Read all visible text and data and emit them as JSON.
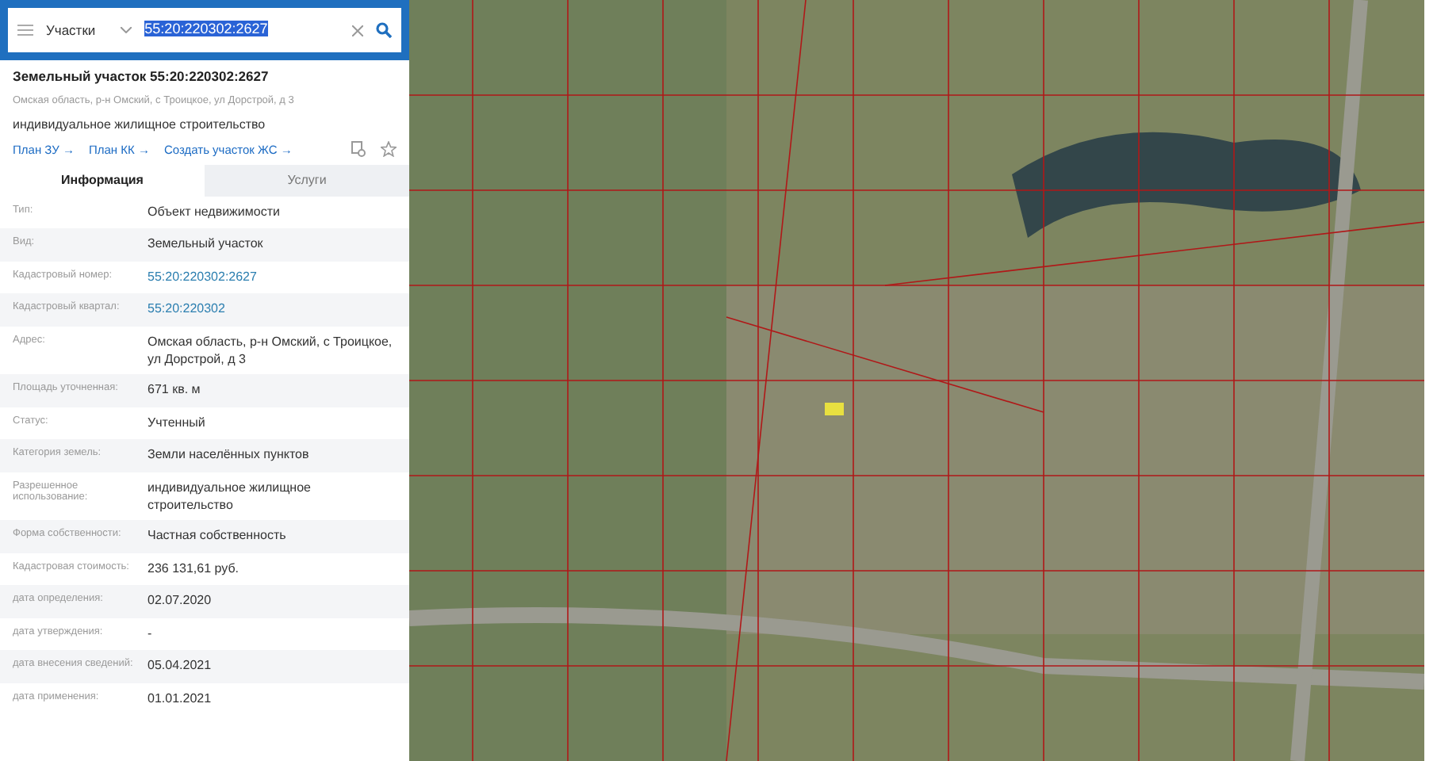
{
  "search": {
    "category": "Участки",
    "query": "55:20:220302:2627",
    "query_highlighted": true
  },
  "parcel": {
    "title": "Земельный участок 55:20:220302:2627",
    "address": "Омская область, р-н Омский, с Троицкое, ул Дорстрой, д 3",
    "usage": "индивидуальное жилищное строительство",
    "links": [
      "План ЗУ →",
      "План КК →",
      "Создать участок ЖС →"
    ]
  },
  "tabs": [
    {
      "label": "Информация",
      "selected": true
    },
    {
      "label": "Услуги",
      "selected": false
    }
  ],
  "properties": [
    {
      "label": "Тип:",
      "value": "Объект недвижимости",
      "kind": "text"
    },
    {
      "label": "Вид:",
      "value": "Земельный участок",
      "kind": "text"
    },
    {
      "label": "Кадастровый номер:",
      "value": "55:20:220302:2627",
      "kind": "link"
    },
    {
      "label": "Кадастровый квартал:",
      "value": "55:20:220302",
      "kind": "link"
    },
    {
      "label": "Адрес:",
      "value": "Омская область, р-н Омский, с Троицкое, ул Дорстрой, д 3",
      "kind": "text"
    },
    {
      "label": "Площадь уточненная:",
      "value": "671 кв. м",
      "kind": "text"
    },
    {
      "label": "Статус:",
      "value": "Учтенный",
      "kind": "text"
    },
    {
      "label": "Категория земель:",
      "value": "Земли населённых пунктов",
      "kind": "text"
    },
    {
      "label": "Разрешенное использование:",
      "value": "индивидуальное жилищное строительство",
      "kind": "text"
    },
    {
      "label": "Форма собственности:",
      "value": "Частная собственность",
      "kind": "text"
    },
    {
      "label": "Кадастровая стоимость:",
      "value": "236 131,61 руб.",
      "kind": "text"
    },
    {
      "label": "дата определения:",
      "value": "02.07.2020",
      "kind": "text"
    },
    {
      "label": "дата утверждения:",
      "value": "-",
      "kind": "text"
    },
    {
      "label": "дата внесения сведений:",
      "value": "05.04.2021",
      "kind": "text"
    },
    {
      "label": "дата применения:",
      "value": "01.01.2021",
      "kind": "text"
    }
  ]
}
